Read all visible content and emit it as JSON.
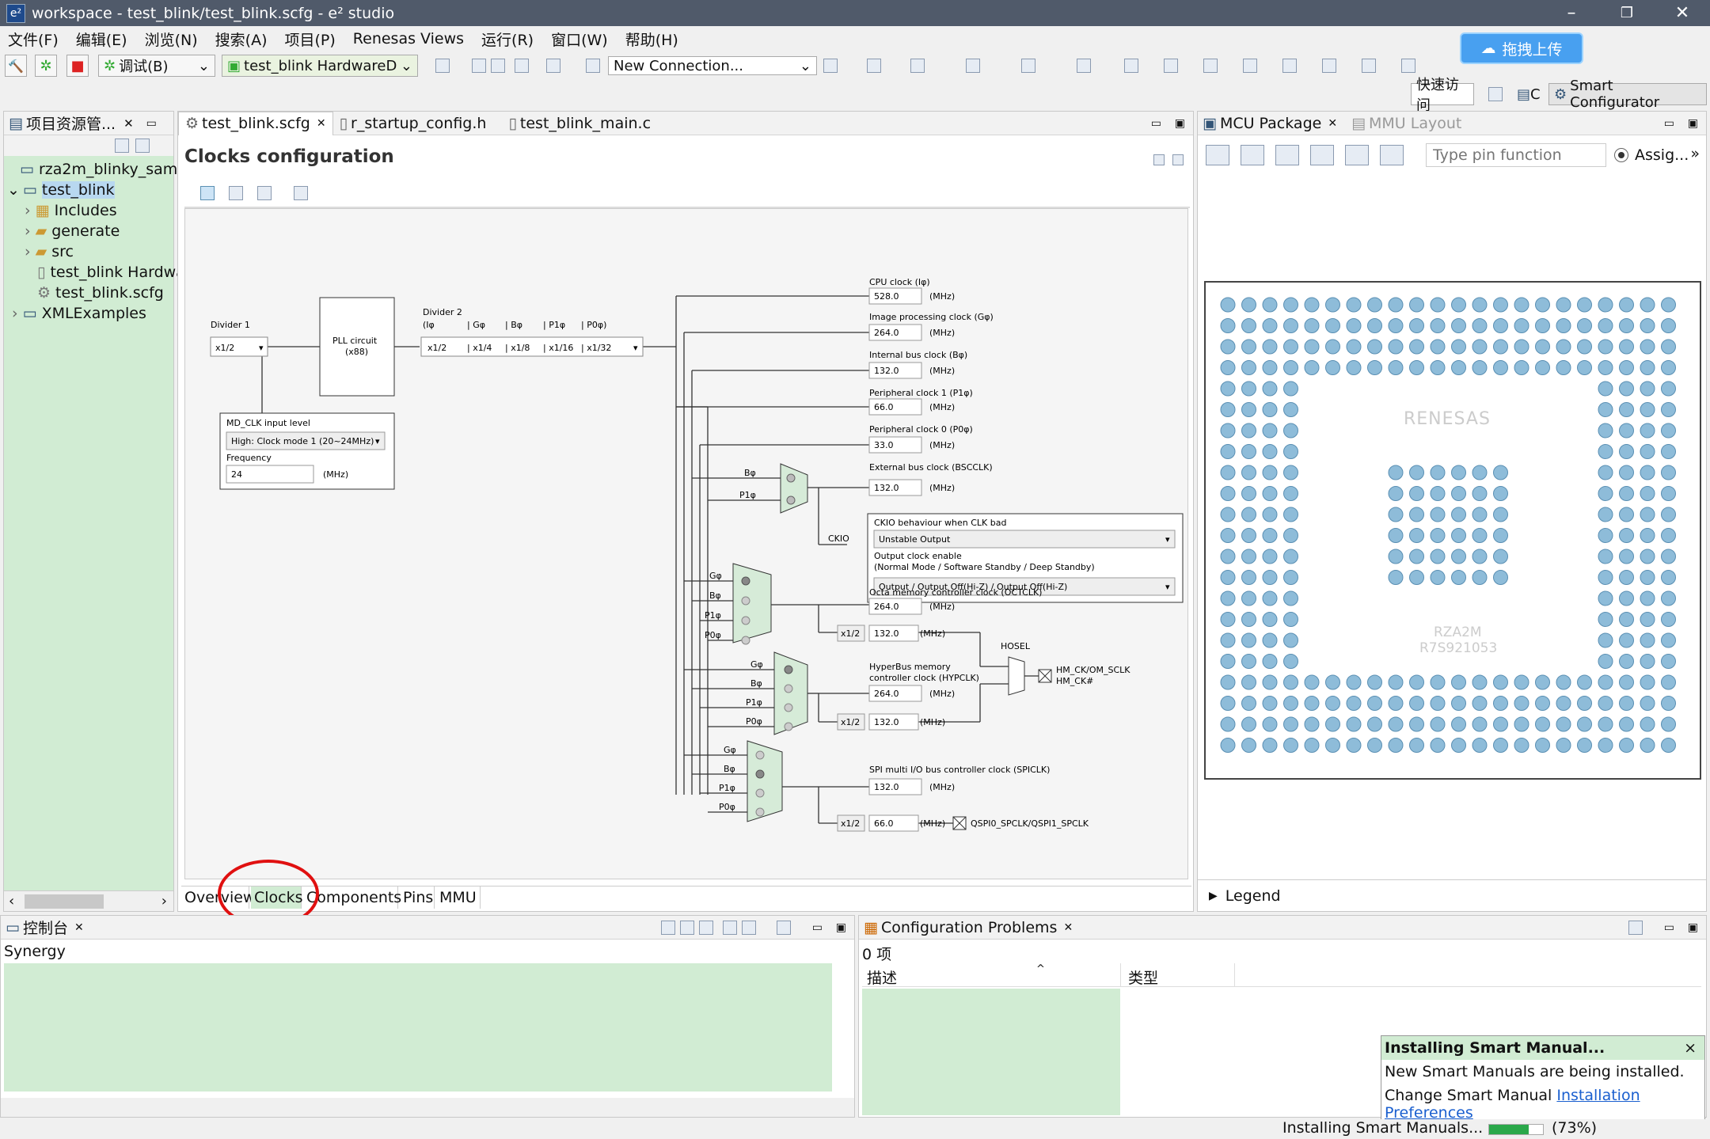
{
  "window": {
    "title": "workspace - test_blink/test_blink.scfg - e² studio",
    "logo": "e²",
    "min": "–",
    "max": "❐",
    "close": "✕"
  },
  "menu": [
    "文件(F)",
    "编辑(E)",
    "浏览(N)",
    "搜索(A)",
    "项目(P)",
    "Renesas Views",
    "运行(R)",
    "窗口(W)",
    "帮助(H)"
  ],
  "toolbar": {
    "debug_label": "调试(B)",
    "hw_config": "test_blink HardwareD",
    "connection": "New Connection...",
    "upload": "拖拽上传",
    "quick_access": "快速访问",
    "perspective_c": "C",
    "perspective_sc": "Smart Configurator"
  },
  "explorer": {
    "title": "项目资源管...",
    "items": [
      "rza2m_blinky_samp",
      "test_blink",
      "Includes",
      "generate",
      "src",
      "test_blink Hardwa",
      "test_blink.scfg",
      "XMLExamples"
    ]
  },
  "editor": {
    "tabs": [
      "test_blink.scfg",
      "r_startup_config.h",
      "test_blink_main.c"
    ],
    "heading": "Clocks configuration",
    "bottom_tabs": [
      "Overview",
      "Clocks",
      "Components",
      "Pins",
      "MMU"
    ]
  },
  "clocks": {
    "divider1": "Divider 1",
    "divider1_val": "x1/2",
    "pll": "PLL circuit",
    "pll_mul": "(x88)",
    "divider2": "Divider 2",
    "d2_labels": [
      "(Iφ",
      "| Gφ",
      "| Bφ",
      "| P1φ",
      "| P0φ)"
    ],
    "d2_vals": [
      "x1/2",
      "| x1/4",
      "| x1/8",
      "| x1/16",
      "| x1/32"
    ],
    "mdclk_title": "MD_CLK input level",
    "mdclk_val": "High: Clock mode 1 (20~24MHz)",
    "freq_label": "Frequency",
    "freq_val": "24",
    "mhz": "(MHz)",
    "cpu_label": "CPU clock (Iφ)",
    "cpu_val": "528.0",
    "img_label": "Image processing clock (Gφ)",
    "img_val": "264.0",
    "ibus_label": "Internal bus clock (Bφ)",
    "ibus_val": "132.0",
    "p1_label": "Peripheral clock 1 (P1φ)",
    "p1_val": "66.0",
    "p0_label": "Peripheral clock 0 (P0φ)",
    "p0_val": "33.0",
    "ext_label": "External bus clock (BSCCLK)",
    "ext_val": "132.0",
    "ckio": "CKIO",
    "ckio_box_title": "CKIO behaviour when CLK bad",
    "ckio_sel": "Unstable Output",
    "out_enable": "Output clock enable",
    "out_modes": "(Normal Mode  / Software Standby  / Deep Standby)",
    "out_sel": "Output          / Output Off(Hi-Z)    / Output Off(Hi-Z)",
    "octa_label": "Octa memory controller clock (OCTCLK)",
    "octa_val": "264.0",
    "octa_half": "132.0",
    "hyper_label1": "HyperBus memory",
    "hyper_label2": "controller clock (HYPCLK)",
    "hyper_val": "264.0",
    "hyper_half": "132.0",
    "hosel": "HOSEL",
    "hm_out1": "HM_CK/OM_SCLK",
    "hm_out2": "HM_CK#",
    "spi_label": "SPI multi I/O bus controller clock (SPICLK)",
    "spi_val": "132.0",
    "spi_half": "66.0",
    "spi_out": "QSPI0_SPCLK/QSPI1_SPCLK",
    "half": "x1/2",
    "mhz2": "(MHz)",
    "mux_b": "Bφ",
    "mux_p1": "P1φ",
    "mux_g": "Gφ",
    "mux_p0": "P0φ"
  },
  "mcu": {
    "tab1": "MCU Package",
    "tab2": "MMU Layout",
    "search_placeholder": "Type pin function",
    "assign": "Assig...",
    "brand": "RENESAS",
    "chip": "RZA2M",
    "part": "R7S921053",
    "legend": "Legend"
  },
  "console": {
    "title": "控制台",
    "content": "Synergy"
  },
  "problems": {
    "title": "Configuration Problems",
    "count": "0 项",
    "col1": "描述",
    "col2": "类型"
  },
  "popup": {
    "title": "Installing Smart Manual...",
    "body": "New Smart Manuals are being installed.",
    "footer_prefix": "Change Smart Manual ",
    "footer_link": "Installation Preferences",
    "close": "×"
  },
  "status": {
    "progress_text": "Installing Smart Manuals...",
    "percent": "(73%)"
  }
}
